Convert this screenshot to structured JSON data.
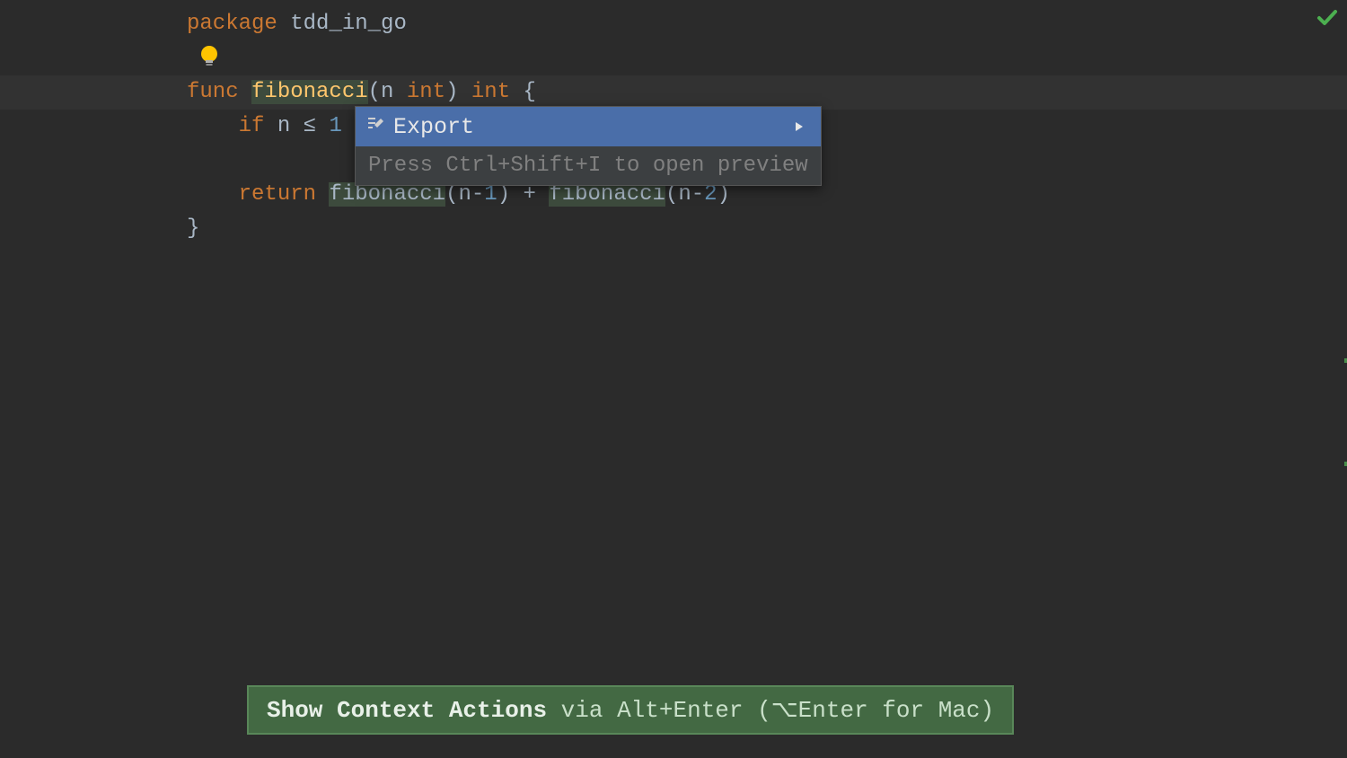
{
  "code": {
    "line1": {
      "kw_package": "package",
      "pkg_name": " tdd_in_go"
    },
    "line3": {
      "kw_func": "func",
      "func_name": "fibonacci",
      "open_paren": "(",
      "param_n": "n ",
      "kw_int1": "int",
      "close_paren": ")",
      "kw_int2": " int",
      "open_brace": " {"
    },
    "line4": {
      "indent": "    ",
      "kw_if": "if",
      "expr": " n ≤ ",
      "num": "1"
    },
    "line6": {
      "indent": "    ",
      "kw_return": "return",
      "sp": " ",
      "call1": "fibonacci",
      "args1a": "(n-",
      "num1": "1",
      "args1b": ")",
      "plus": " + ",
      "call2": "fibonacci",
      "args2a": "(n-",
      "num2": "2",
      "args2b": ")"
    },
    "line7": {
      "close_brace": "}"
    }
  },
  "popup": {
    "export_label": "Export",
    "hint": "Press Ctrl+Shift+I to open preview"
  },
  "tooltip": {
    "bold_part": "Show Context Actions",
    "rest": " via Alt+Enter (⌥Enter for Mac)"
  }
}
